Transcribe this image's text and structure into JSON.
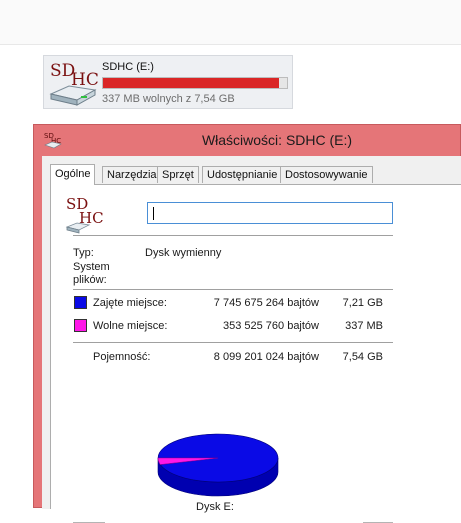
{
  "drive_tile": {
    "name": "SDHC (E:)",
    "free_text": "337 MB wolnych z 7,54 GB",
    "used_fraction": 0.956,
    "bar_color": "#da2626",
    "icon": "sdhc-drive-icon",
    "icon_text_a": "SD",
    "icon_text_b": "HC"
  },
  "dialog": {
    "title": "Właściwości: SDHC (E:)",
    "title_bar_color": "#e57578",
    "tabs": [
      {
        "label": "Ogólne",
        "active": true
      },
      {
        "label": "Narzędzia",
        "active": false
      },
      {
        "label": "Sprzęt",
        "active": false
      },
      {
        "label": "Udostępnianie",
        "active": false
      },
      {
        "label": "Dostosowywanie",
        "active": false
      }
    ],
    "general": {
      "name_value": "",
      "type_label": "Typ:",
      "type_value": "Dysk wymienny",
      "fs_label_1": "System",
      "fs_label_2": "plików:",
      "fs_value": "",
      "used_label": "Zajęte miejsce:",
      "used_bytes": "7 745 675 264 bajtów",
      "used_size": "7,21 GB",
      "used_color": "#0a0ae6",
      "free_label": "Wolne miejsce:",
      "free_bytes": "353 525 760 bajtów",
      "free_size": "337 MB",
      "free_color": "#ff17e8",
      "capacity_label": "Pojemność:",
      "capacity_bytes": "8 099 201 024 bajtów",
      "capacity_size": "7,54 GB",
      "pie_used_fraction": 0.956,
      "disk_label": "Dysk E:"
    }
  }
}
